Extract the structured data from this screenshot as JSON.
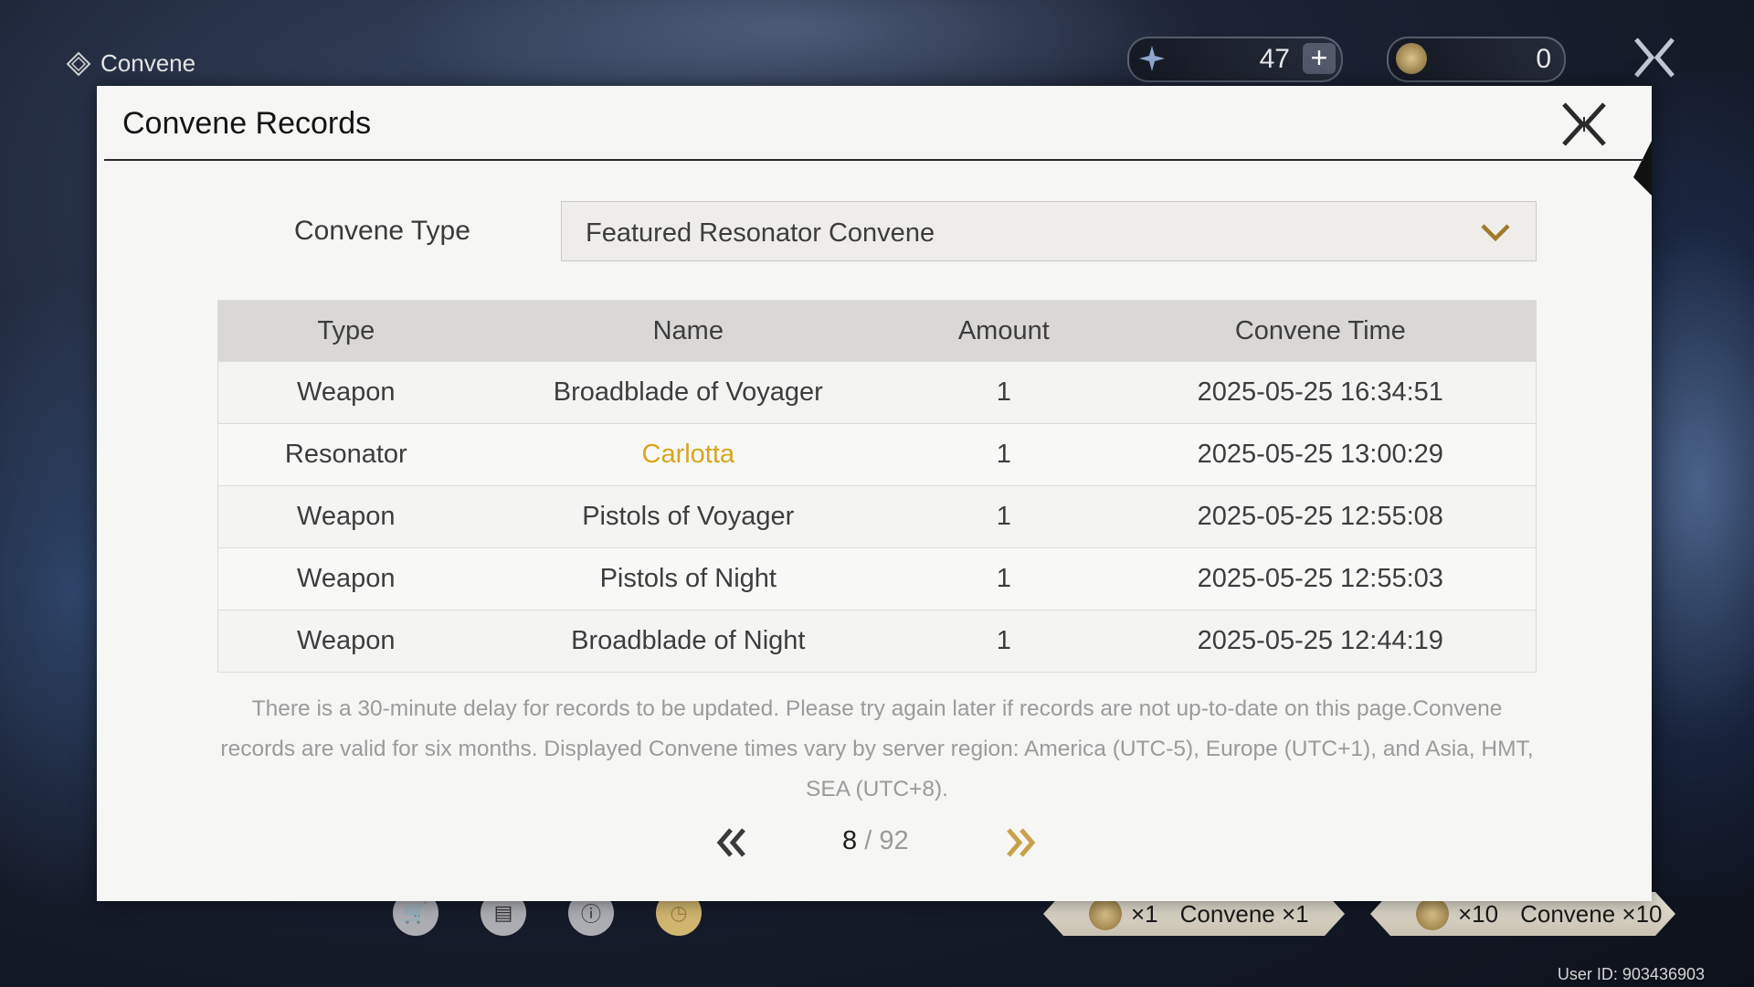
{
  "screen_title": "Convene",
  "currencies": {
    "astrite": {
      "value": "47",
      "icon": "astrite-star-icon"
    },
    "lustrous": {
      "value": "0",
      "icon": "lustrous-tide-coin-icon"
    }
  },
  "modal": {
    "title": "Convene Records",
    "convene_type_label": "Convene Type",
    "convene_type_value": "Featured Resonator Convene",
    "table": {
      "headers": [
        "Type",
        "Name",
        "Amount",
        "Convene Time"
      ],
      "rows": [
        {
          "type": "Weapon",
          "name": "Broadblade of Voyager",
          "amount": "1",
          "time": "2025-05-25 16:34:51",
          "rarity": "normal"
        },
        {
          "type": "Resonator",
          "name": "Carlotta",
          "amount": "1",
          "time": "2025-05-25 13:00:29",
          "rarity": "gold"
        },
        {
          "type": "Weapon",
          "name": "Pistols of Voyager",
          "amount": "1",
          "time": "2025-05-25 12:55:08",
          "rarity": "normal"
        },
        {
          "type": "Weapon",
          "name": "Pistols of Night",
          "amount": "1",
          "time": "2025-05-25 12:55:03",
          "rarity": "normal"
        },
        {
          "type": "Weapon",
          "name": "Broadblade of Night",
          "amount": "1",
          "time": "2025-05-25 12:44:19",
          "rarity": "normal"
        }
      ]
    },
    "notice": "There is a 30-minute delay for records to be updated. Please try again later if records are not up-to-date on this page.Convene records are valid for six months. Displayed Convene times vary by server region: America (UTC-5), Europe (UTC+1), and Asia, HMT, SEA (UTC+8).",
    "pagination": {
      "current": "8",
      "separator": " / ",
      "total": "92"
    }
  },
  "bottom_bar": {
    "icons": [
      "shop-cart-icon",
      "details-search-icon",
      "info-icon",
      "history-clock-icon"
    ],
    "convene_one": {
      "count": "×1",
      "label": "Convene ×1"
    },
    "convene_ten": {
      "count": "×10",
      "label": "Convene ×10"
    },
    "user_id": "User ID: 903436903"
  },
  "colors": {
    "gold_accent": "#d8a51e",
    "chevron_gold": "#a07a2c",
    "modal_bg": "#f6f6f4",
    "header_row_bg": "#d9d8d6"
  }
}
